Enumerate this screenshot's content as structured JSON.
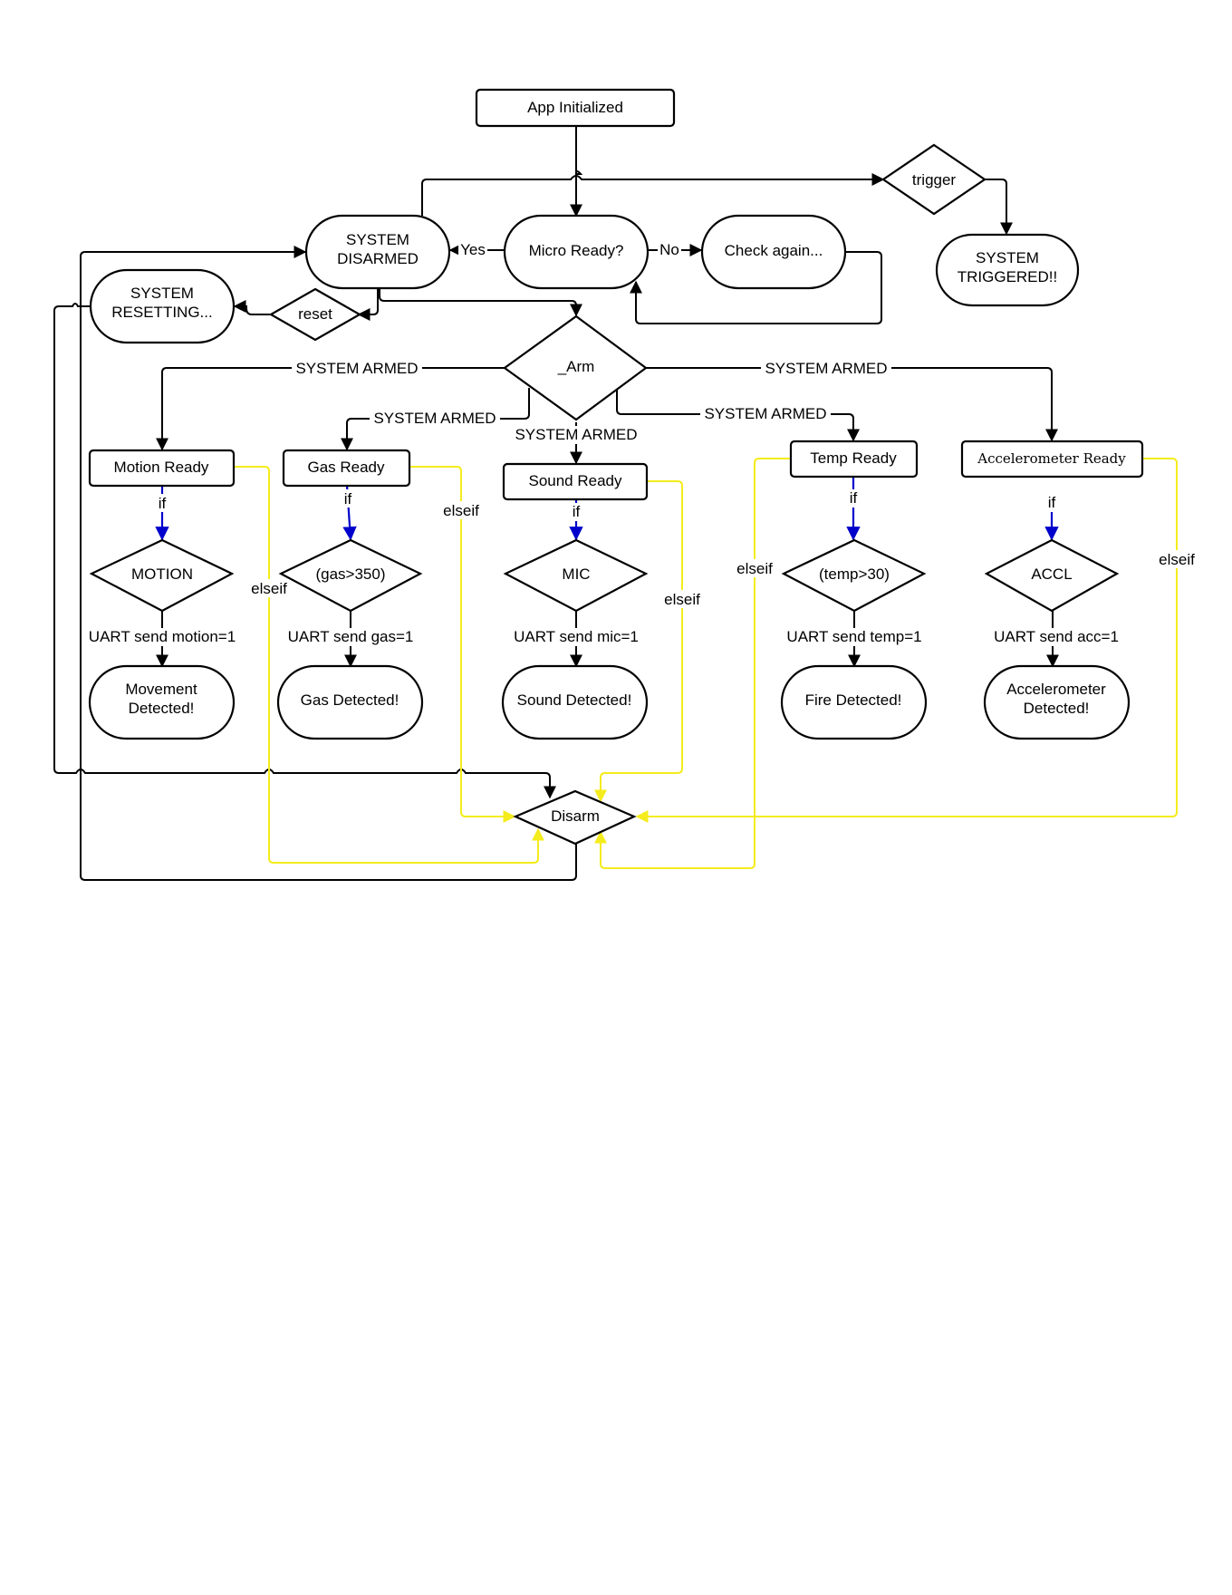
{
  "diagram": {
    "type": "flowchart",
    "colors": {
      "normal_edge": "#000000",
      "if_edge": "#0000cc",
      "elseif_edge": "#f4ec1c"
    },
    "nodes": {
      "app_initialized": "App Initialized",
      "trigger": "trigger",
      "system_triggered": [
        "SYSTEM",
        "TRIGGERED!!"
      ],
      "system_disarmed": [
        "SYSTEM",
        "DISARMED"
      ],
      "micro_ready": "Micro Ready?",
      "check_again": "Check again...",
      "system_resetting": [
        "SYSTEM",
        "RESETTING..."
      ],
      "reset": "reset",
      "arm": "_Arm",
      "motion_ready": "Motion Ready",
      "gas_ready": "Gas Ready",
      "sound_ready": "Sound Ready",
      "temp_ready": "Temp Ready",
      "accel_ready": "Accelerometer Ready",
      "motion": "MOTION",
      "gas_cond": "(gas>350)",
      "mic": "MIC",
      "temp_cond": "(temp>30)",
      "accl": "ACCL",
      "movement_detected": [
        "Movement",
        "Detected!"
      ],
      "gas_detected": "Gas Detected!",
      "sound_detected": "Sound Detected!",
      "fire_detected": "Fire Detected!",
      "accel_detected": [
        "Accelerometer",
        "Detected!"
      ],
      "disarm": "Disarm"
    },
    "edge_labels": {
      "yes": "Yes",
      "no": "No",
      "system_armed": "SYSTEM ARMED",
      "if": "if",
      "elseif": "elseif",
      "uart_motion": "UART send motion=1",
      "uart_gas": "UART send gas=1",
      "uart_mic": "UART send mic=1",
      "uart_temp": "UART send temp=1",
      "uart_acc": "UART send acc=1"
    },
    "edges": [
      {
        "from": "app_initialized",
        "to": "micro_ready"
      },
      {
        "from": "micro_ready",
        "to": "system_disarmed",
        "label": "Yes"
      },
      {
        "from": "micro_ready",
        "to": "check_again",
        "label": "No"
      },
      {
        "from": "check_again",
        "to": "micro_ready"
      },
      {
        "from": "system_disarmed",
        "to": "trigger"
      },
      {
        "from": "trigger",
        "to": "system_triggered"
      },
      {
        "from": "system_disarmed",
        "to": "reset"
      },
      {
        "from": "reset",
        "to": "system_resetting"
      },
      {
        "from": "system_disarmed",
        "to": "arm"
      },
      {
        "from": "arm",
        "to": "motion_ready",
        "label": "SYSTEM ARMED"
      },
      {
        "from": "arm",
        "to": "gas_ready",
        "label": "SYSTEM ARMED"
      },
      {
        "from": "arm",
        "to": "sound_ready",
        "label": "SYSTEM ARMED"
      },
      {
        "from": "arm",
        "to": "temp_ready",
        "label": "SYSTEM ARMED"
      },
      {
        "from": "arm",
        "to": "accel_ready",
        "label": "SYSTEM ARMED"
      },
      {
        "from": "motion_ready",
        "to": "motion",
        "label": "if",
        "kind": "if"
      },
      {
        "from": "gas_ready",
        "to": "gas_cond",
        "label": "if",
        "kind": "if"
      },
      {
        "from": "sound_ready",
        "to": "mic",
        "label": "if",
        "kind": "if"
      },
      {
        "from": "temp_ready",
        "to": "temp_cond",
        "label": "if",
        "kind": "if"
      },
      {
        "from": "accel_ready",
        "to": "accl",
        "label": "if",
        "kind": "if"
      },
      {
        "from": "motion",
        "to": "movement_detected",
        "label": "UART send motion=1"
      },
      {
        "from": "gas_cond",
        "to": "gas_detected",
        "label": "UART send gas=1"
      },
      {
        "from": "mic",
        "to": "sound_detected",
        "label": "UART send mic=1"
      },
      {
        "from": "temp_cond",
        "to": "fire_detected",
        "label": "UART send temp=1"
      },
      {
        "from": "accl",
        "to": "accel_detected",
        "label": "UART send acc=1"
      },
      {
        "from": "motion_ready",
        "to": "disarm",
        "label": "elseif",
        "kind": "elseif"
      },
      {
        "from": "gas_ready",
        "to": "disarm",
        "label": "elseif",
        "kind": "elseif"
      },
      {
        "from": "sound_ready",
        "to": "disarm",
        "label": "elseif",
        "kind": "elseif"
      },
      {
        "from": "temp_ready",
        "to": "disarm",
        "label": "elseif",
        "kind": "elseif"
      },
      {
        "from": "accel_ready",
        "to": "disarm",
        "label": "elseif",
        "kind": "elseif"
      },
      {
        "from": "system_resetting",
        "to": "disarm"
      },
      {
        "from": "disarm",
        "to": "system_disarmed"
      }
    ]
  }
}
